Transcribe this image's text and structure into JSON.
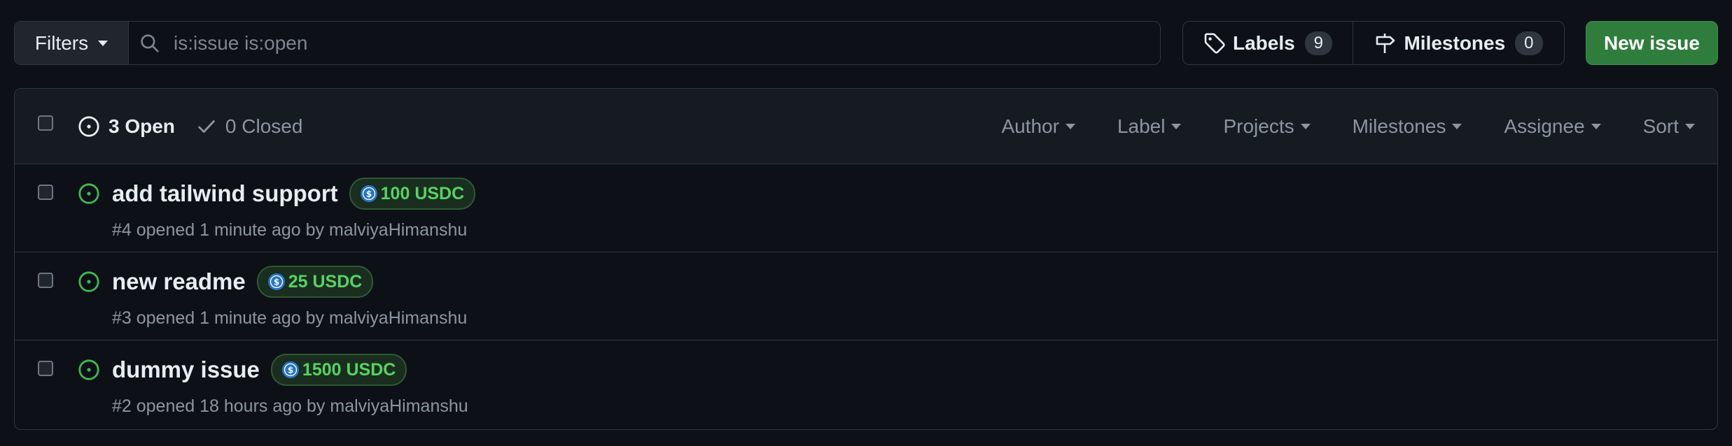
{
  "toolbar": {
    "filters_label": "Filters",
    "search_placeholder": "is:issue is:open",
    "labels_label": "Labels",
    "labels_count": "9",
    "milestones_label": "Milestones",
    "milestones_count": "0",
    "new_issue_label": "New issue"
  },
  "issues_header": {
    "open_label": "3 Open",
    "closed_label": "0 Closed",
    "filters": [
      "Author",
      "Label",
      "Projects",
      "Milestones",
      "Assignee",
      "Sort"
    ]
  },
  "issues": [
    {
      "title": "add tailwind support",
      "bounty": "100 USDC",
      "meta": "#4 opened 1 minute ago by malviyaHimanshu"
    },
    {
      "title": "new readme",
      "bounty": "25 USDC",
      "meta": "#3 opened 1 minute ago by malviyaHimanshu"
    },
    {
      "title": "dummy issue",
      "bounty": "1500 USDC",
      "meta": "#2 opened 18 hours ago by malviyaHimanshu"
    }
  ],
  "colors": {
    "background": "#0d1117",
    "open_green": "#3fb950",
    "bounty_green": "#56d364",
    "primary_button": "#2f7d3d",
    "usdc_blue": "#2775ca"
  },
  "icons": {
    "search": "search-icon",
    "labels": "tag-icon",
    "milestones": "milestone-icon",
    "open": "issue-opened-icon",
    "closed": "check-icon",
    "bounty": "usdc-icon"
  }
}
